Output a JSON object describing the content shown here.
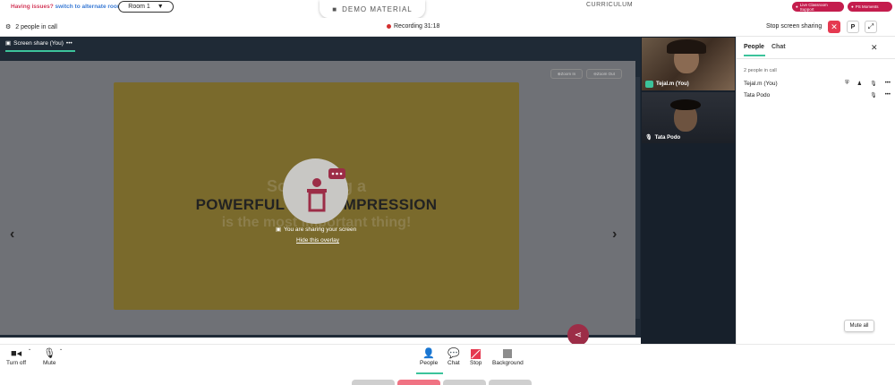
{
  "top": {
    "issues_text": "Having issues?",
    "issues_link": "switch to alternate room",
    "room_select": "Room 1",
    "demo_material": "DEMO MATERIAL",
    "curriculum": "CURRICULUM",
    "support_pill": "Live Classroom Support",
    "moments_pill": "PS Moments"
  },
  "call_header": {
    "people_in_call": "2 people in call",
    "recording": "Recording 31:18",
    "stop_sharing": "Stop screen sharing",
    "pin_label": "P"
  },
  "stage": {
    "share_tab": "Screen share (You)",
    "zoom_in": "Zoom In",
    "zoom_out": "Zoom Out",
    "slide_line1": "So, making a",
    "slide_line2": "POWERFUL FIRST IMPRESSION",
    "slide_line3": "is the most important thing!",
    "overlay_message": "You are sharing your screen",
    "overlay_hide": "Hide this overlay"
  },
  "tiles": [
    {
      "name": "Tejal.m (You)"
    },
    {
      "name": "Tata Podo"
    }
  ],
  "side_panel": {
    "tab_people": "People",
    "tab_chat": "Chat",
    "count": "2 people in call",
    "people": [
      {
        "name": "Tejal.m (You)"
      },
      {
        "name": "Tata Podo"
      }
    ],
    "mute_all": "Mute all"
  },
  "toolbar": {
    "turn_off": "Turn off",
    "mute": "Mute",
    "people": "People",
    "chat": "Chat",
    "stop": "Stop",
    "background": "Background"
  },
  "colors": {
    "accent_green": "#3cc39b",
    "danger_red": "#e53950",
    "brand_crimson": "#c41d4d"
  }
}
